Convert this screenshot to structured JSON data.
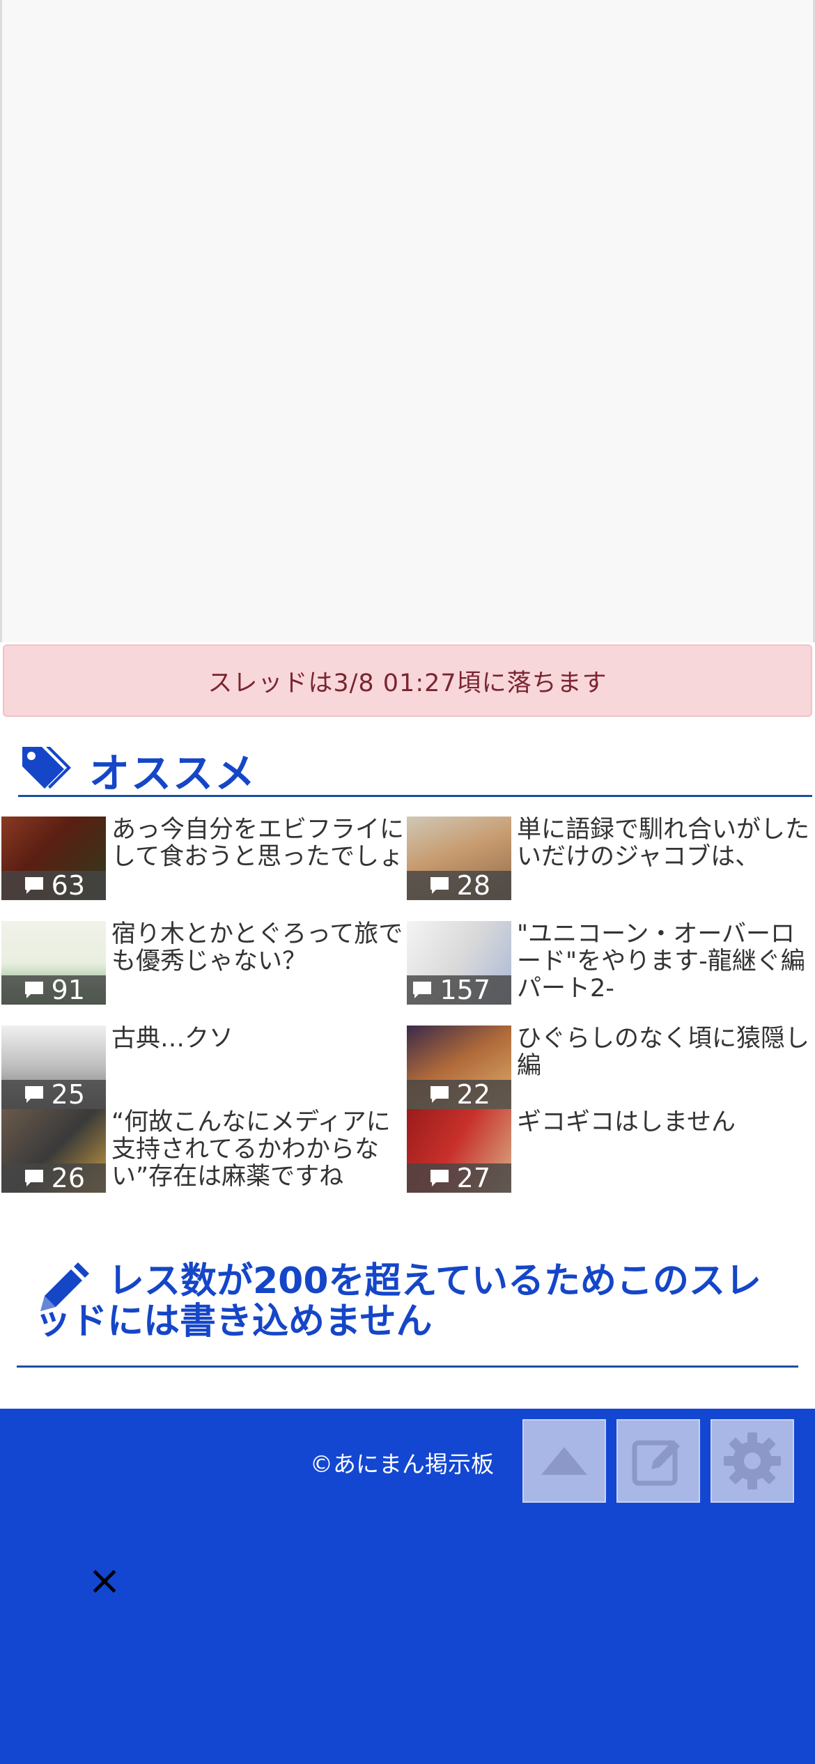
{
  "notice": "スレッドは3/8 01:27頃に落ちます",
  "recommend": {
    "title": "オススメ",
    "items": [
      {
        "title": "あっ今自分をエビフライにして食おうと思ったでしょ",
        "count": "63"
      },
      {
        "title": "単に語録で馴れ合いがしたいだけのジャコブは、",
        "count": "28"
      },
      {
        "title": "宿り木とかとぐろって旅でも優秀じゃない？",
        "count": "91"
      },
      {
        "title": "\"ユニコーン・オーバーロード\"をやります-龍継ぐ編パート2-",
        "count": "157"
      },
      {
        "title": "古典…クソ",
        "count": "25"
      },
      {
        "title": "ひぐらしのなく頃に猿隠し編",
        "count": "22"
      },
      {
        "title": "“何故こんなにメディアに支持されてるかわからない”存在は麻薬ですね",
        "count": "26"
      },
      {
        "title": "ギコギコはしません",
        "count": "27"
      }
    ]
  },
  "closed_message": "レス数が200を超えているためこのスレッドには書き込めません",
  "footer": {
    "copyright": "©あにまん掲示板",
    "buttons": [
      "scroll-top",
      "write",
      "settings"
    ],
    "close_symbol": "×"
  },
  "colors": {
    "accent": "#1546c8",
    "footer_bg": "#1347d2",
    "notice_bg": "#f8d7da"
  }
}
